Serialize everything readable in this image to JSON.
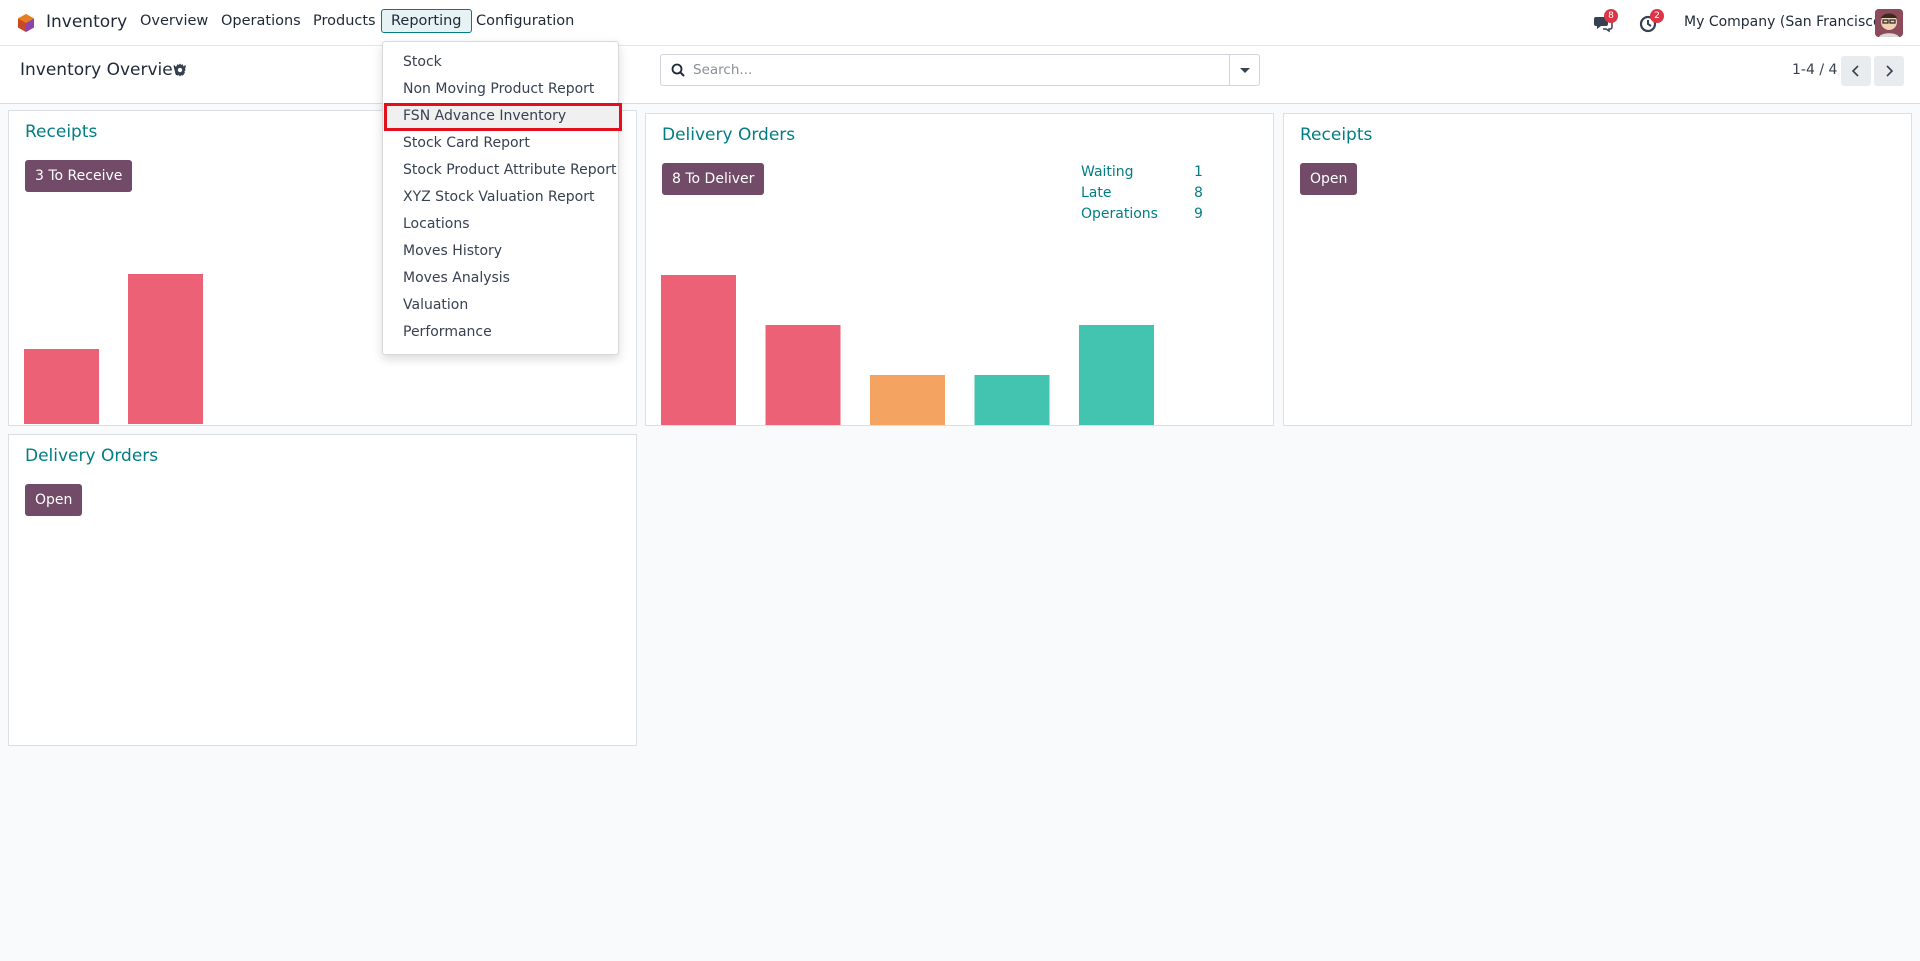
{
  "navbar": {
    "app_name": "Inventory",
    "menu": [
      {
        "label": "Overview"
      },
      {
        "label": "Operations"
      },
      {
        "label": "Products"
      },
      {
        "label": "Reporting"
      },
      {
        "label": "Configuration"
      }
    ],
    "messages_badge": "8",
    "activities_badge": "2",
    "company": "My Company (San Francisco)"
  },
  "control": {
    "title": "Inventory Overview",
    "search_placeholder": "Search...",
    "pager": "1-4 / 4"
  },
  "dropdown": {
    "items": [
      {
        "label": "Stock"
      },
      {
        "label": "Non Moving Product Report"
      },
      {
        "label": "FSN Advance Inventory"
      },
      {
        "label": "Stock Card Report"
      },
      {
        "label": "Stock Product Attribute Report"
      },
      {
        "label": "XYZ Stock Valuation Report"
      },
      {
        "label": "Locations"
      },
      {
        "label": "Moves History"
      },
      {
        "label": "Moves Analysis"
      },
      {
        "label": "Valuation"
      },
      {
        "label": "Performance"
      }
    ]
  },
  "cards": [
    {
      "title": "Receipts",
      "button": "3 To Receive",
      "chart_values": [
        1,
        2
      ],
      "colors": [
        "#ec6176",
        "#ec6176"
      ]
    },
    {
      "title": "Delivery Orders",
      "button": "8 To Deliver",
      "stats": [
        {
          "label": "Waiting",
          "value": "1"
        },
        {
          "label": "Late",
          "value": "8"
        },
        {
          "label": "Operations",
          "value": "9"
        }
      ],
      "chart_values": [
        3,
        2,
        1,
        1,
        2
      ],
      "colors": [
        "#ec6176",
        "#ec6176",
        "#f4a460",
        "#43c4b0",
        "#43c4b0"
      ]
    },
    {
      "title": "Receipts",
      "button": "Open"
    },
    {
      "title": "Delivery Orders",
      "button": "Open"
    }
  ],
  "colors": {
    "brand": "#714b67",
    "accent": "#017e84",
    "highlight_border": "#e3101b"
  }
}
